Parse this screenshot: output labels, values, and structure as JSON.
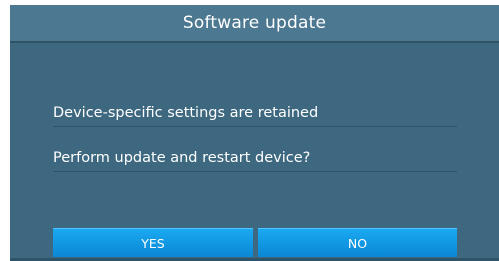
{
  "dialog": {
    "title": "Software update",
    "messages": [
      "Device-specific settings are retained",
      "Perform update and restart device?"
    ],
    "buttons": {
      "yes_label": "YES",
      "no_label": "NO"
    }
  },
  "colors": {
    "background": "#3e6880",
    "title_bar": "#4d7891",
    "button": "#0f95e0",
    "text": "#ffffff"
  }
}
